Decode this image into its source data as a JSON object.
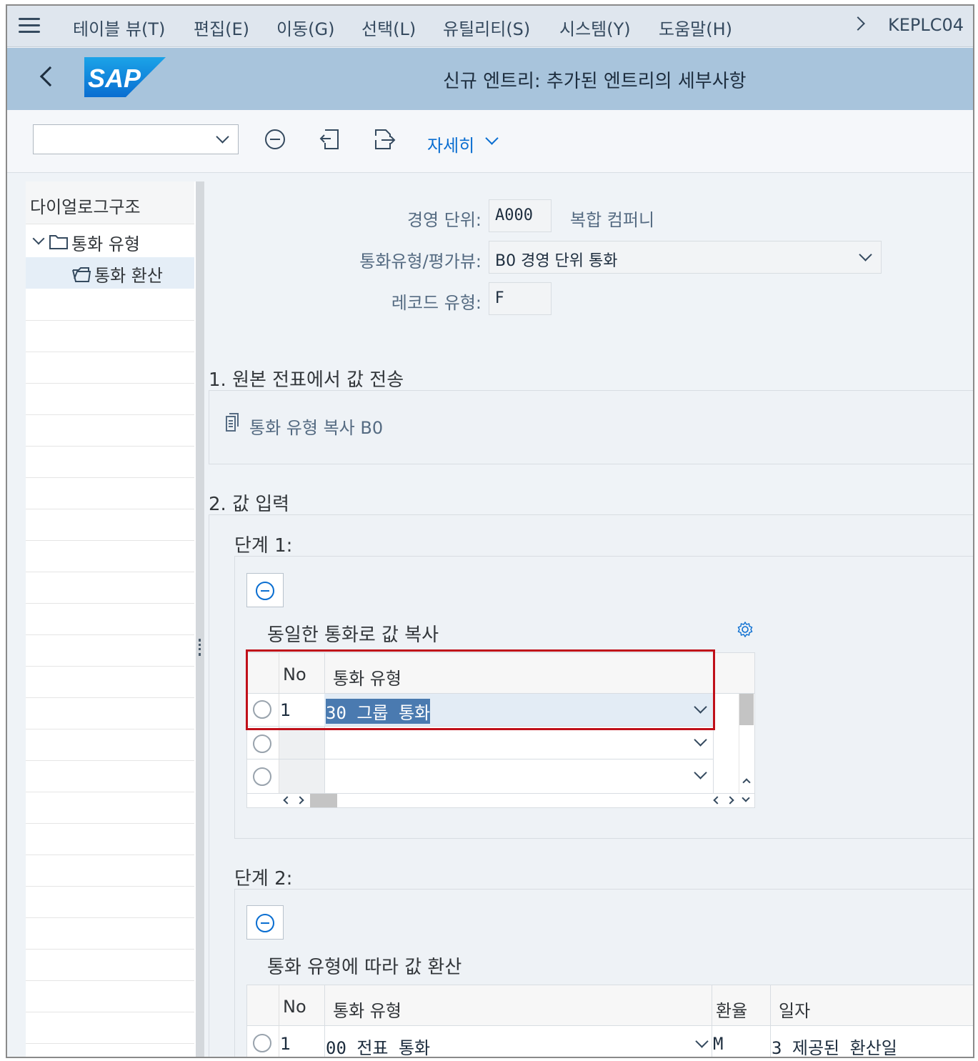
{
  "menubar": {
    "items": [
      "테이블 뷰(T)",
      "편집(E)",
      "이동(G)",
      "선택(L)",
      "유틸리티(S)",
      "시스템(Y)",
      "도움말(H)"
    ],
    "system_id": "KEPLC04"
  },
  "titlebar": {
    "logo_text": "SAP",
    "title": "신규 엔트리: 추가된 엔트리의 세부사항"
  },
  "toolbar": {
    "select_value": "",
    "more_label": "자세히"
  },
  "tree": {
    "header": "다이얼로그구조",
    "items": [
      {
        "label": "통화 유형",
        "expanded": true
      },
      {
        "label": "통화 환산",
        "selected": true
      }
    ]
  },
  "form": {
    "company_label": "경영 단위:",
    "company_value": "A000",
    "company_desc": "복합 컴퍼니",
    "currency_type_label": "통화유형/평가뷰:",
    "currency_type_value": "B0 경영 단위 통화",
    "record_type_label": "레코드 유형:",
    "record_type_value": "F"
  },
  "section1": {
    "title": "1. 원본 전표에서 값 전송",
    "link": "통화 유형 복사 B0"
  },
  "section2": {
    "title": "2. 값 입력",
    "step1": {
      "title": "단계 1:",
      "table_title": "동일한 통화로 값 복사",
      "columns": [
        "No",
        "통화 유형"
      ],
      "rows": [
        {
          "no": "1",
          "currency_type": "30 그룹 통화"
        },
        {
          "no": "",
          "currency_type": ""
        },
        {
          "no": "",
          "currency_type": ""
        }
      ]
    },
    "step2": {
      "title": "단계 2:",
      "table_title": "통화 유형에 따라 값 환산",
      "columns": [
        "No",
        "통화 유형",
        "환율",
        "일자"
      ],
      "rows": [
        {
          "no": "1",
          "currency_type": "00 전표 통화",
          "rate": "M",
          "date": "3 제공된 환산일"
        }
      ]
    }
  },
  "colors": {
    "accent": "#0a6ed1",
    "titlebar": "#a8c4dc",
    "highlight": "#c0101a"
  }
}
